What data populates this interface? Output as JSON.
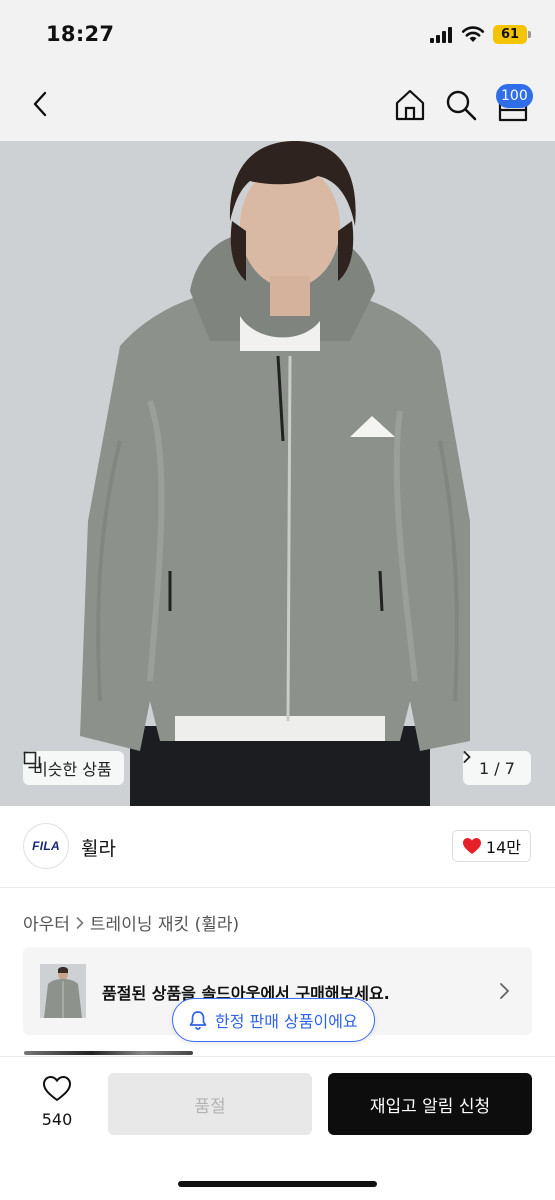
{
  "status_bar": {
    "time": "18:27",
    "battery": "61"
  },
  "header": {
    "cart_badge": "100",
    "icons": [
      "back-arrow-icon",
      "home-icon",
      "search-icon",
      "cart-icon"
    ]
  },
  "gallery": {
    "similar_label": "비슷한 상품",
    "pager_text": "1 / 7"
  },
  "brand": {
    "logo_text": "FILA",
    "name": "휠라",
    "like_count": "14만",
    "like_color": "#e8202a"
  },
  "breadcrumb": {
    "category": "아우터",
    "subcategory": "트레이닝 재킷 (휠라)"
  },
  "soldout_banner": {
    "text": "품절된 상품을 솔드아웃에서 구매해보세요."
  },
  "limited_notice": {
    "text": "한정 판매 상품이에요",
    "color": "#2f63e6"
  },
  "bottom_bar": {
    "wish_count": "540",
    "soldout_label": "품절",
    "restock_label": "재입고 알림 신청"
  }
}
